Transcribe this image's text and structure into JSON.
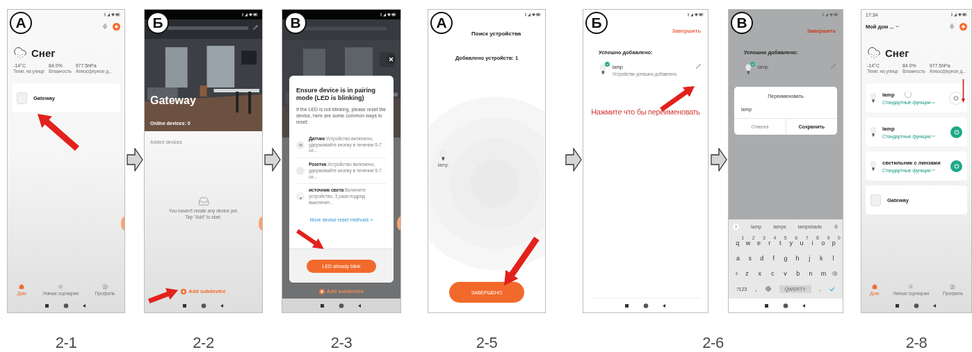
{
  "figures": [
    {
      "caption": "2-1",
      "screens": [
        {
          "kind": "home",
          "badge": "А",
          "weather": {
            "condition": "Снег",
            "stats": [
              {
                "value": "-14°C",
                "label": "Темп. на улице"
              },
              {
                "value": "84.0%",
                "label": "Влажность"
              },
              {
                "value": "977.5hPa",
                "label": "Атмосферное д..."
              }
            ]
          },
          "devices": [
            {
              "name": "Gateway",
              "kind": "gateway"
            }
          ],
          "nav": [
            {
              "label": "Дом",
              "kind": "home",
              "selected": true
            },
            {
              "label": "Умные сценарии",
              "kind": "scenes",
              "selected": false
            },
            {
              "label": "Профиль",
              "kind": "profile",
              "selected": false
            }
          ]
        }
      ]
    },
    {
      "caption": "2-2",
      "screens": [
        {
          "kind": "gateway",
          "flow_arrow": true,
          "badge": "Б",
          "title": "Gateway",
          "online": "Online devices: 0",
          "section": "Added devices",
          "empty_lines": [
            "You haven't create any device yet.",
            "Tap \"Add\" to start."
          ],
          "add_label": "Add subdevice"
        }
      ]
    },
    {
      "caption": "2-3",
      "screens": [
        {
          "kind": "pairing",
          "flow_arrow": true,
          "badge": "В",
          "title": "Ensure device is in pairing mode (LED is blinking)",
          "body": "If the LED is not blinking, please reset the device, here are some common ways to reset:",
          "methods": [
            {
              "kind": "sensor",
              "name": "Датчик",
              "text": "Устройство включено, удерживайте кнопку в течении 5-7 се..."
            },
            {
              "kind": "socket",
              "name": "Розетка",
              "text": "Устройство включено, удерживайте кнопку в течении 5-7 се..."
            },
            {
              "kind": "bulb",
              "name": "источник света",
              "text": "Включите устройство, 3 раза подряд выключит..."
            }
          ],
          "link": "More device reset methods >",
          "button": "LED already blink",
          "add_label": "Add subdevice"
        }
      ]
    },
    {
      "caption": "2-5",
      "screens": [
        {
          "kind": "search",
          "badge": "А",
          "title": "Поиск устройства",
          "count": "Добавлено устройств: 1",
          "device": "lamp",
          "button": "ЗАВЕРШЕНО"
        }
      ]
    },
    {
      "caption": "2-6",
      "screens": [
        {
          "kind": "added",
          "flow_arrow": true,
          "badge": "Б",
          "action": "Завершить",
          "heading": "Успешно добавлено:",
          "device": {
            "name": "lamp",
            "status": "Устройство успешно добавлено",
            "checked": true
          },
          "note": "Нажмите что бы переименовать"
        },
        {
          "kind": "rename",
          "flow_arrow": true,
          "badge": "В",
          "action": "Завершить",
          "heading": "Успешно добавлено:",
          "device": {
            "name": "lamp",
            "checked": true
          },
          "dialog": {
            "title": "Переименовать",
            "value": "lamp",
            "cancel": "Отмена",
            "save": "Сохранить"
          },
          "keyboard": {
            "suggestions": [
              "lamp",
              "lamps",
              "lampshade"
            ],
            "key_rows": [
              {
                "keys": [
                  {
                    "key": "q",
                    "hint": "1"
                  },
                  {
                    "key": "w",
                    "hint": "2"
                  },
                  {
                    "key": "e",
                    "hint": "3"
                  },
                  {
                    "key": "r",
                    "hint": "4"
                  },
                  {
                    "key": "t",
                    "hint": "5"
                  },
                  {
                    "key": "y",
                    "hint": "6"
                  },
                  {
                    "key": "u",
                    "hint": "7"
                  },
                  {
                    "key": "i",
                    "hint": "8"
                  },
                  {
                    "key": "o",
                    "hint": "9"
                  },
                  {
                    "key": "p",
                    "hint": "0"
                  }
                ]
              },
              {
                "keys": [
                  {
                    "key": "a"
                  },
                  {
                    "key": "s"
                  },
                  {
                    "key": "d"
                  },
                  {
                    "key": "f"
                  },
                  {
                    "key": "g"
                  },
                  {
                    "key": "h"
                  },
                  {
                    "key": "j"
                  },
                  {
                    "key": "k"
                  },
                  {
                    "key": "l"
                  }
                ]
              },
              {
                "keys": [
                  {
                    "key": "z"
                  },
                  {
                    "key": "x"
                  },
                  {
                    "key": "c"
                  },
                  {
                    "key": "v"
                  },
                  {
                    "key": "b"
                  },
                  {
                    "key": "n"
                  },
                  {
                    "key": "m"
                  }
                ]
              }
            ],
            "symbols": "?123",
            "comma": ",",
            "space": "QWERTY",
            "period": "."
          }
        }
      ]
    },
    {
      "caption": "2-8",
      "screens": [
        {
          "kind": "home",
          "time": "17:34",
          "home_name": "Мой дом ...",
          "weather": {
            "condition": "Снег",
            "stats": [
              {
                "value": "-14°C",
                "label": "Темп. на улице"
              },
              {
                "value": "84.0%",
                "label": "Влажность"
              },
              {
                "value": "977.5hPa",
                "label": "Атмосферное д..."
              }
            ]
          },
          "devices": [
            {
              "name": "lamp",
              "kind": "bulb",
              "sub": "Стандартные функции",
              "busy": true,
              "on": false
            },
            {
              "name": "lamp",
              "kind": "bulb",
              "sub": "Стандартные функции",
              "on": true
            },
            {
              "name": "светильник с линзами",
              "kind": "bulb",
              "sub": "Стандартные функции",
              "on": true
            },
            {
              "name": "Gateway",
              "kind": "gateway"
            }
          ],
          "nav": [
            {
              "label": "Дом",
              "kind": "home",
              "selected": true
            },
            {
              "label": "Умные сценарии",
              "kind": "scenes",
              "selected": false
            },
            {
              "label": "Профиль",
              "kind": "profile",
              "selected": false
            }
          ]
        }
      ]
    }
  ]
}
